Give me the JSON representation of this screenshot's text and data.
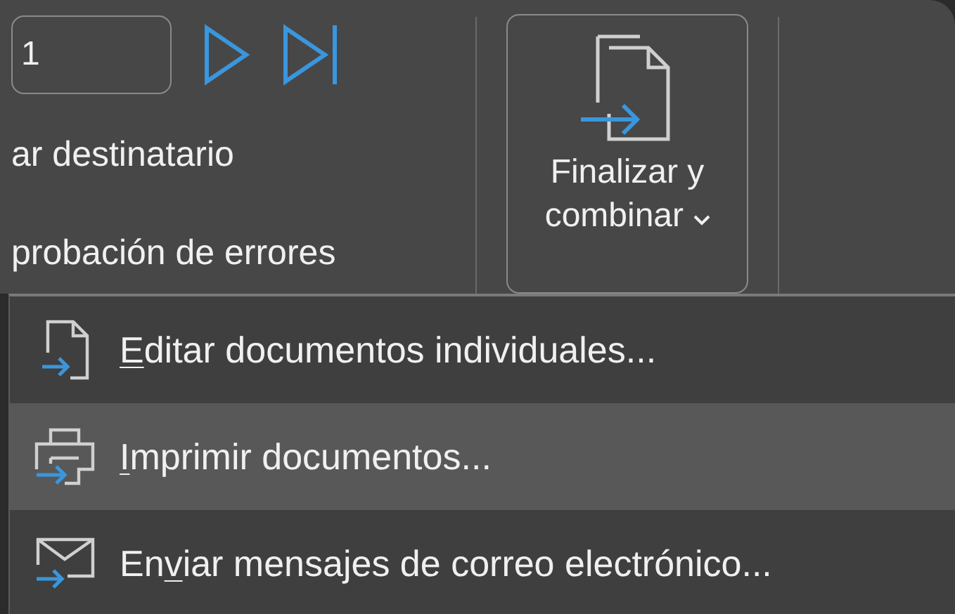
{
  "ribbon": {
    "record_field": {
      "value": "1"
    },
    "nav_buttons": [
      {
        "kind": "next"
      },
      {
        "kind": "last"
      }
    ],
    "commands": [
      "ar destinatario",
      "probación de errores"
    ],
    "finish_button": {
      "line_1": "Finalizar y",
      "line_2": "combinar",
      "pressed": true
    }
  },
  "menu": {
    "items": [
      {
        "kind": "edit",
        "access_key": "E",
        "label_after": "ditar documentos individuales...",
        "hovered": false
      },
      {
        "kind": "print",
        "access_key": "I",
        "label_after": "mprimir documentos...",
        "hovered": true
      },
      {
        "kind": "email",
        "label_before": "En",
        "access_key": "v",
        "label_after": "iar mensajes de correo electrónico...",
        "hovered": false
      }
    ]
  }
}
